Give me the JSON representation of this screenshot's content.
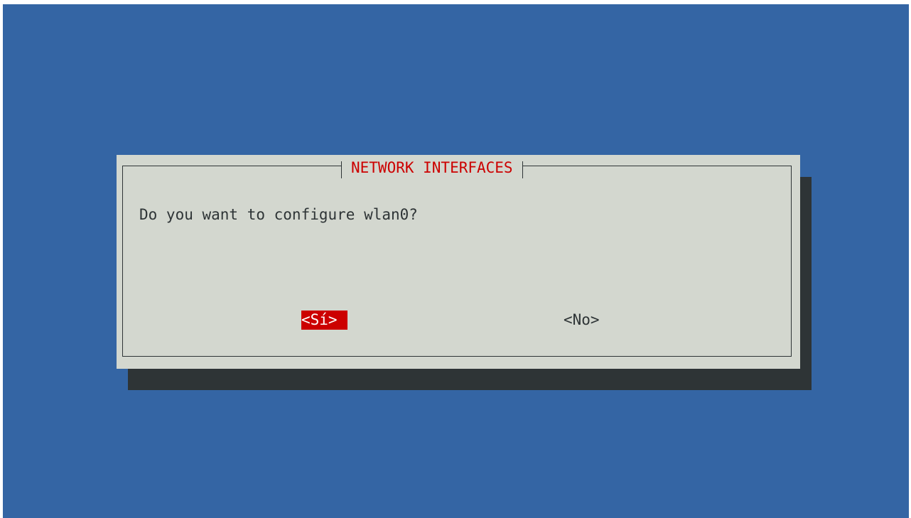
{
  "dialog": {
    "title": "NETWORK INTERFACES",
    "message": "Do you want to configure wlan0?",
    "buttons": {
      "yes_label": "<Sí>",
      "no_label": "<No>"
    },
    "selected_button": "yes"
  },
  "colors": {
    "background": "#3465a4",
    "dialog": "#d3d7cf",
    "shadow": "#2e3436",
    "title": "#cc0000",
    "selected_button_bg": "#cc0000",
    "selected_button_fg": "#ffffff",
    "text": "#2e3436"
  }
}
